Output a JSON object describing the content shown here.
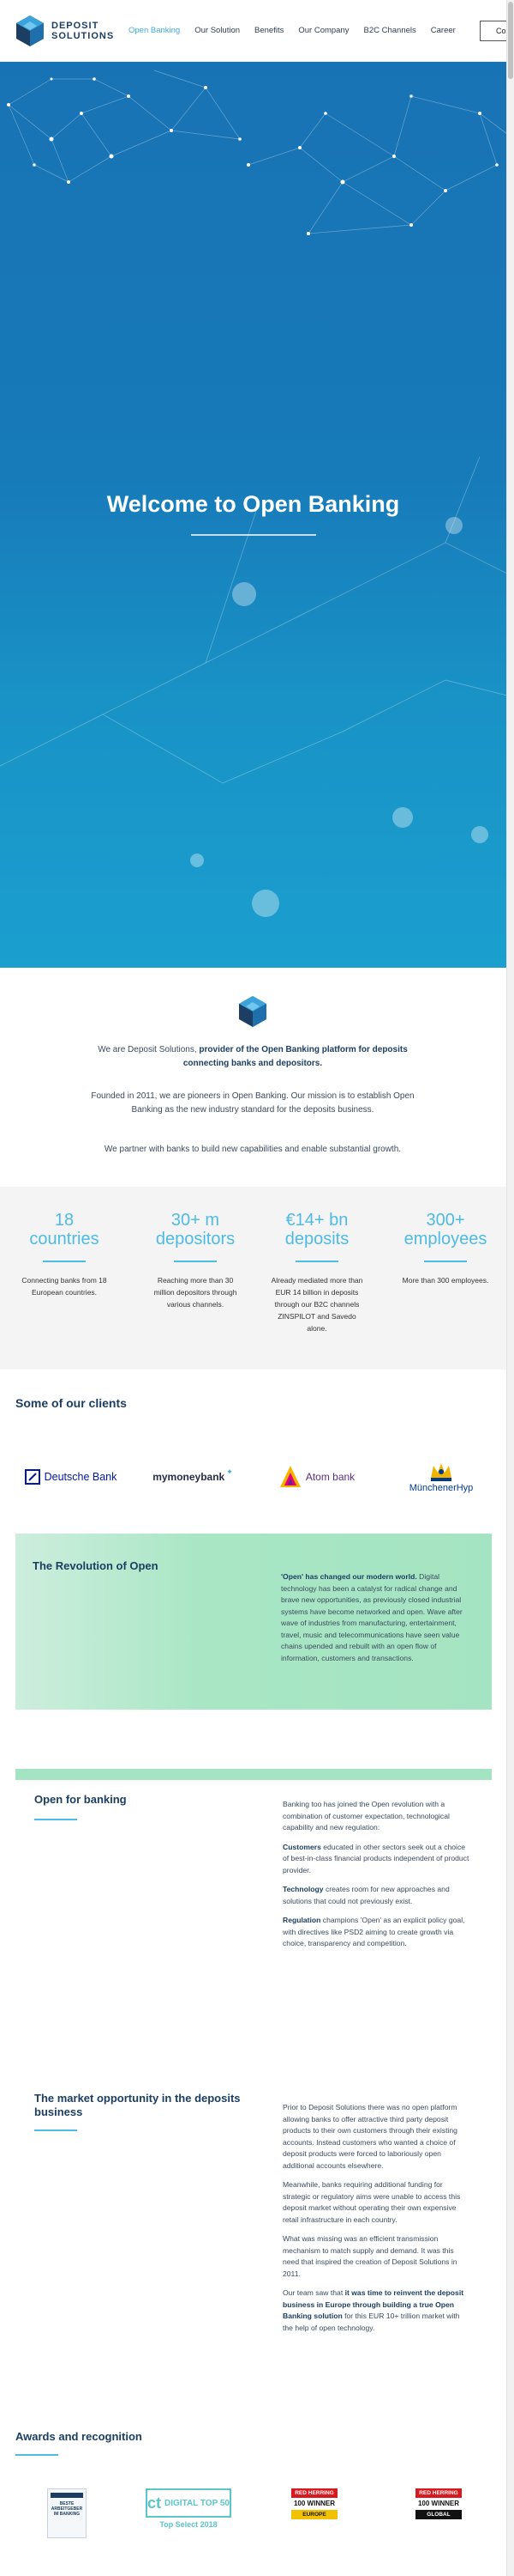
{
  "brand": {
    "line1": "DEPOSIT",
    "line2": "SOLUTIONS",
    "accent": "#3fa9e0",
    "navy": "#1c3e62"
  },
  "nav": {
    "items": [
      "Open Banking",
      "Our Solution",
      "Benefits",
      "Our Company",
      "B2C Channels",
      "Career"
    ],
    "active": "Open Banking",
    "contact_label": "Co"
  },
  "hero": {
    "title": "Welcome to Open Banking"
  },
  "intro": {
    "p1_plain": "We are Deposit Solutions, ",
    "p1_bold": "provider of the Open Banking platform for deposits connecting banks and depositors.",
    "p2": "Founded in 2011, we are pioneers in Open Banking. Our mission is to establish Open Banking as the new industry standard for the deposits business.",
    "p3": "We partner with banks to build new capabilities and enable substantial growth."
  },
  "stats": [
    {
      "number": "18",
      "unit": "countries",
      "text": "Connecting banks from 18 European countries."
    },
    {
      "number": "30+ m",
      "unit": "depositors",
      "text": "Reaching more than 30 million depositors through various channels."
    },
    {
      "number": "€14+ bn",
      "unit": "deposits",
      "text": "Already mediated more than EUR 14 billion in deposits through our B2C channels ZINSPILOT and Savedo alone."
    },
    {
      "number": "300+",
      "unit": "employees",
      "text": "More than 300 employees."
    }
  ],
  "clients": {
    "title": "Some of our clients",
    "logos": [
      "Deutsche Bank",
      "mymoneybank",
      "Atom bank",
      "MünchenerHyp"
    ]
  },
  "revolution": {
    "title": "The Revolution of Open",
    "bold": "'Open' has changed our modern world.",
    "text": " Digital technology has been a catalyst for radical change and brave new opportunities, as previously closed industrial systems have become networked and open. Wave after wave of industries from manufacturing, entertainment, travel, music and telecommunications have seen value chains upended and rebuilt with an open flow of information, customers and transactions."
  },
  "open_banking": {
    "title": "Open for banking",
    "intro": "Banking too has joined the Open revolution with a combination of customer expectation, technological capability and new regulation:",
    "p1_bold": "Customers",
    "p1": " educated in other sectors seek out a choice of best-in-class financial products independent of product provider.",
    "p2_bold": "Technology",
    "p2": " creates room for new approaches and solutions that could not previously exist.",
    "p3_bold": "Regulation",
    "p3": " champions 'Open' as an explicit policy goal, with directives like PSD2 aiming to create growth via choice, transparency and competition."
  },
  "market": {
    "title": "The market opportunity in the deposits business",
    "p1": "Prior to Deposit Solutions there was no open platform allowing banks to offer attractive third party deposit products to their own customers through their existing accounts. Instead customers who wanted a choice of deposit products were forced to laboriously open additional accounts elsewhere.",
    "p2": "Meanwhile, banks requiring additional funding for strategic or regulatory aims were unable to access this deposit market without operating their own expensive retail infrastructure in each country.",
    "p3": "What was missing was an efficient transmission mechanism to match supply and demand. It was this need that inspired the creation of Deposit Solutions in 2011.",
    "p4_plain": "Our team saw that ",
    "p4_bold": "it was time to reinvent the deposit business in Europe through building a true Open Banking solution",
    "p4_end": " for this EUR 10+ trillion market with the help of open technology."
  },
  "awards": {
    "title": "Awards and recognition",
    "items": [
      {
        "label": "BESTE ARBEITGEBER IM BANKING"
      },
      {
        "label": "DIGITAL TOP 50",
        "sub": "Top Select 2018"
      },
      {
        "label": "RED HERRING",
        "sub": "100 WINNER",
        "sub2": "EUROPE"
      },
      {
        "label": "RED HERRING",
        "sub": "100 WINNER",
        "sub2": "GLOBAL"
      }
    ]
  }
}
